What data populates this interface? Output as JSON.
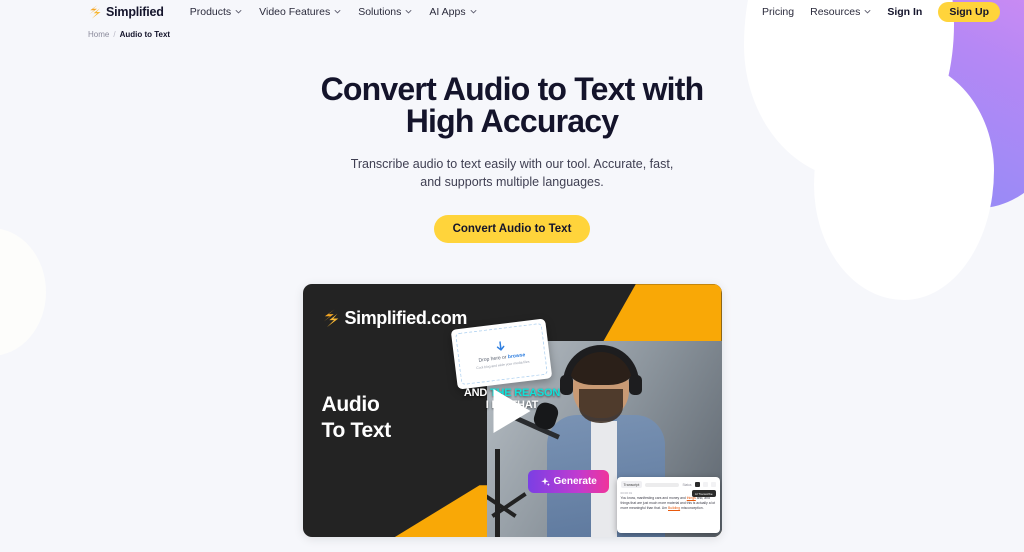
{
  "brand": {
    "name": "Simplified",
    "logo_icon": "simplified-logo-icon"
  },
  "nav": {
    "items": [
      {
        "label": "Products",
        "caret": "chevron-down-icon"
      },
      {
        "label": "Video Features",
        "caret": "chevron-down-icon"
      },
      {
        "label": "Solutions",
        "caret": "chevron-down-icon"
      },
      {
        "label": "AI Apps",
        "caret": "chevron-down-icon"
      }
    ],
    "pricing": "Pricing",
    "resources": "Resources",
    "sign_in": "Sign In",
    "sign_up": "Sign Up"
  },
  "breadcrumb": {
    "home": "Home",
    "separator": "/",
    "current": "Audio to Text"
  },
  "hero": {
    "title": "Convert Audio to Text with High Accuracy",
    "subtitle": "Transcribe audio to text easily with our tool. Accurate, fast, and supports multiple languages.",
    "cta": "Convert Audio to Text"
  },
  "video_card": {
    "logo_text": "Simplified.com",
    "title_line1": "Audio",
    "title_line2": "To Text",
    "play_label": "play-button",
    "drop_card": {
      "primary": "Drop here or ",
      "link": "browse",
      "secondary": "Cool blog and wide your media files"
    },
    "caption": {
      "line1_plain": "AND ",
      "line1_highlight": "THE REASON",
      "line2": "I DO THAT"
    },
    "generate_button": {
      "label": "Generate",
      "icon": "sparkle-icon"
    },
    "transcript": {
      "title": "Transcript",
      "status": "Status",
      "badge": "AI Transcribe",
      "timestamp": "00:00:01",
      "text_a": "You know, manifesting cars and money and ",
      "text_link_a": "things",
      "text_b": " and, and things that are just much more material and this is actually a lot more meaningful than that. Um ",
      "text_link_b": "Building",
      "text_c": " misconception."
    }
  },
  "colors": {
    "accent_yellow": "#ffd43b",
    "card_orange": "#f9a806",
    "dark": "#232323",
    "caption_highlight": "#12e0d8",
    "page_bg": "#f6f7fb"
  }
}
